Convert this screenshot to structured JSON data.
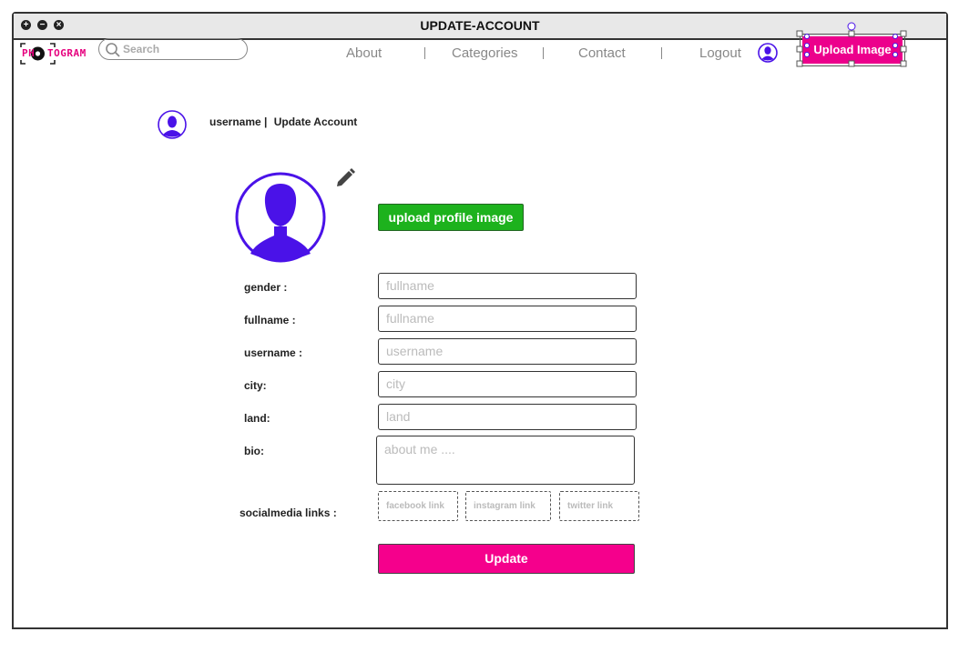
{
  "window": {
    "title": "UPDATE-ACCOUNT",
    "controls": [
      "maximize-icon",
      "minimize-icon",
      "close-icon"
    ]
  },
  "header": {
    "logo_left": "PH",
    "logo_right": "TOGRAM",
    "search_placeholder": "Search",
    "nav": [
      "About",
      "Categories",
      "Contact",
      "Logout"
    ],
    "upload_label": "Upload Image",
    "brand_color": "#ec008c"
  },
  "breadcrumb": {
    "username": "username |",
    "page": "Update Account"
  },
  "profile": {
    "upload_label": "upload profile image",
    "avatar_color": "#4a12e8"
  },
  "form": {
    "fields": [
      {
        "label": "gender :",
        "placeholder": "fullname"
      },
      {
        "label": "fullname :",
        "placeholder": "fullname"
      },
      {
        "label": "username :",
        "placeholder": "username"
      },
      {
        "label": "city:",
        "placeholder": "city"
      },
      {
        "label": "land:",
        "placeholder": "land"
      }
    ],
    "bio_label": "bio:",
    "bio_placeholder": "about me ....",
    "social_label": "socialmedia links :",
    "social": [
      "facebook link",
      "instagram link",
      "twitter link"
    ],
    "submit_label": "Update"
  }
}
